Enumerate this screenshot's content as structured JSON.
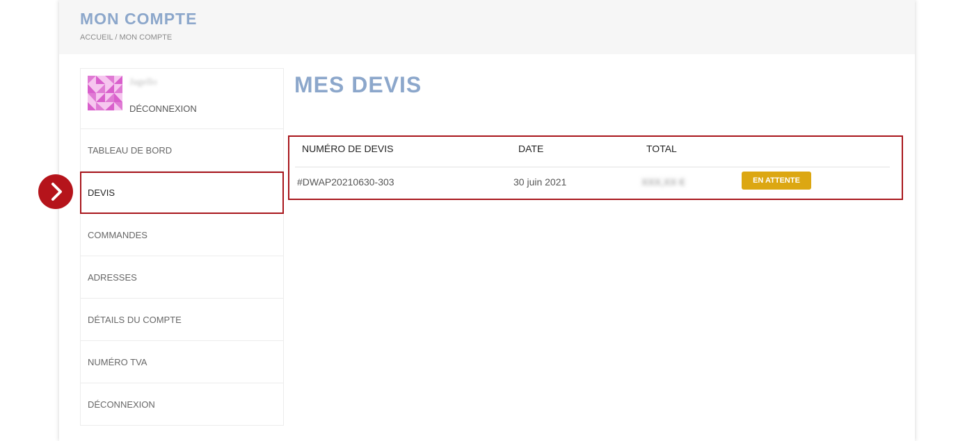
{
  "header": {
    "title": "MON COMPTE",
    "breadcrumb": "ACCUEIL / MON COMPTE"
  },
  "user": {
    "name": "Jagello",
    "logout_label": "DÉCONNEXION",
    "avatar_color": "#f3b9ea"
  },
  "sidebar": {
    "items": [
      {
        "label": "TABLEAU DE BORD",
        "active": false
      },
      {
        "label": "DEVIS",
        "active": true
      },
      {
        "label": "COMMANDES",
        "active": false
      },
      {
        "label": "ADRESSES",
        "active": false
      },
      {
        "label": "DÉTAILS DU COMPTE",
        "active": false
      },
      {
        "label": "NUMÉRO TVA",
        "active": false
      },
      {
        "label": "DÉCONNEXION",
        "active": false
      }
    ]
  },
  "annotation": {
    "icon": "chevron-right-icon",
    "color": "#b5141b"
  },
  "main": {
    "title": "MES DEVIS",
    "table": {
      "columns": [
        "NUMÉRO DE DEVIS",
        "DATE",
        "TOTAL"
      ],
      "rows": [
        {
          "number": "#DWAP20210630-303",
          "date": "30 juin 2021",
          "total": "XXX,XX €",
          "status": "EN ATTENTE"
        }
      ]
    }
  },
  "colors": {
    "accent_title": "#8ca7cb",
    "highlight": "#a8151b",
    "status_pending": "#dca712"
  }
}
